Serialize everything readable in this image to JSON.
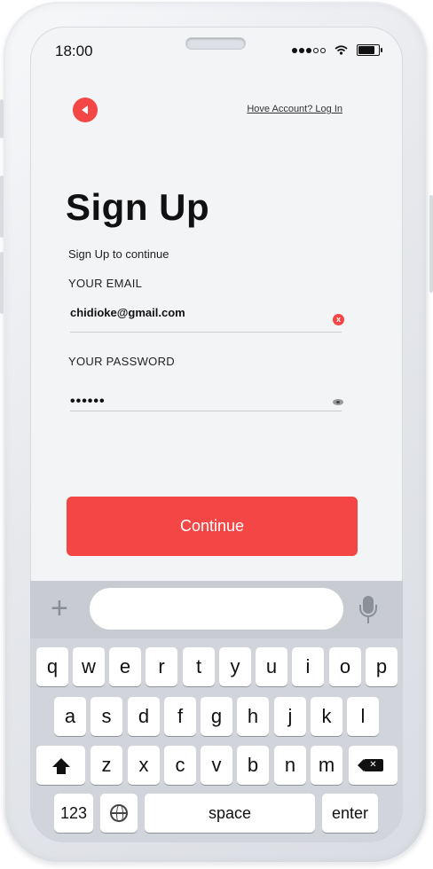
{
  "status_bar": {
    "time": "18:00"
  },
  "header": {
    "back_icon": "back-arrow-icon",
    "login_link": "Hove Account? Log In"
  },
  "page": {
    "title": "Sign Up",
    "subtitle": "Sign Up to continue"
  },
  "form": {
    "email_label": "YOUR EMAIL",
    "email_value": "chidioke@gmail.com",
    "clear_icon_glyph": "x",
    "password_label": "YOUR PASSWORD",
    "password_value": "••••••",
    "continue_label": "Continue"
  },
  "keyboard": {
    "row1": [
      "q",
      "w",
      "e",
      "r",
      "t",
      "y",
      "u",
      "i",
      "o",
      "p"
    ],
    "row2": [
      "a",
      "s",
      "d",
      "f",
      "g",
      "h",
      "j",
      "k",
      "l"
    ],
    "row3": [
      "z",
      "x",
      "c",
      "v",
      "b",
      "n",
      "m"
    ],
    "plus": "+",
    "numbers_key": "123",
    "space_key": "space",
    "enter_key": "enter"
  },
  "colors": {
    "accent": "#f54646",
    "screen_bg": "#f3f4f6",
    "keyboard_bg": "#d1d4db"
  }
}
